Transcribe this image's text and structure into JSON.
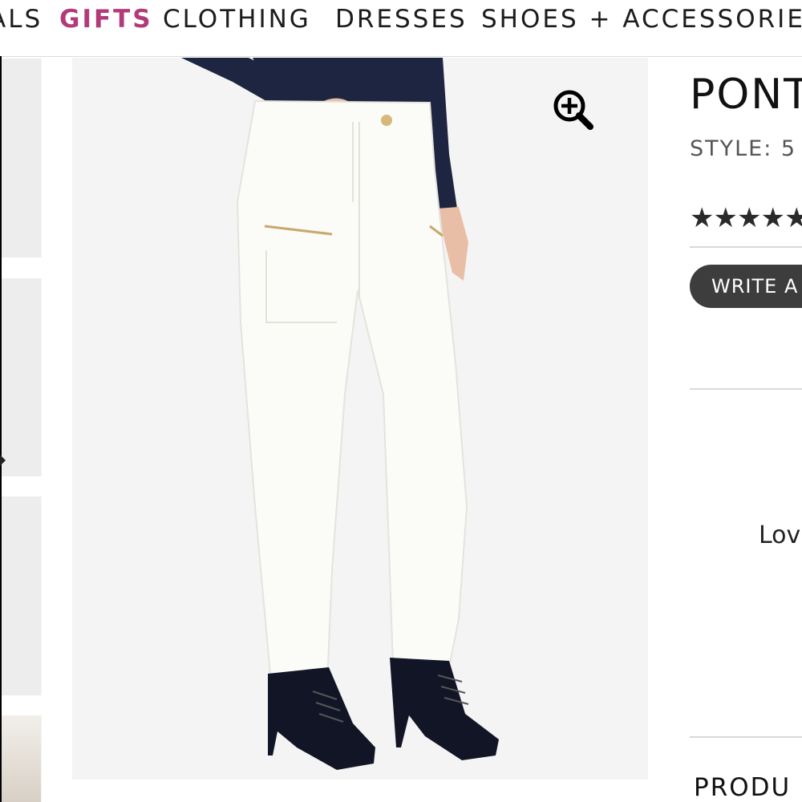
{
  "nav": {
    "items": [
      {
        "label": "ALS",
        "active": false
      },
      {
        "label": "GIFTS",
        "active": true
      },
      {
        "label": "CLOTHING",
        "active": false
      },
      {
        "label": "DRESSES",
        "active": false
      },
      {
        "label": "SHOES + ACCESSORIES",
        "active": false
      }
    ],
    "active_color": "#b23a79"
  },
  "gallery": {
    "thumbnail_count": 5,
    "zoom_icon": "zoom-in-icon",
    "product_image": "model wearing white skinny jeans with zip pockets and black lace-up peep-toe booties"
  },
  "product": {
    "title": "PONT",
    "style_text": "STYLE: 5",
    "rating_icon": "star-icon",
    "write_review_label": "WRITE A",
    "review_snippet": "Lov",
    "section_heading": "PRODU"
  },
  "colors": {
    "button_bg": "#3d3d3d",
    "image_bg": "#f4f4f4"
  }
}
